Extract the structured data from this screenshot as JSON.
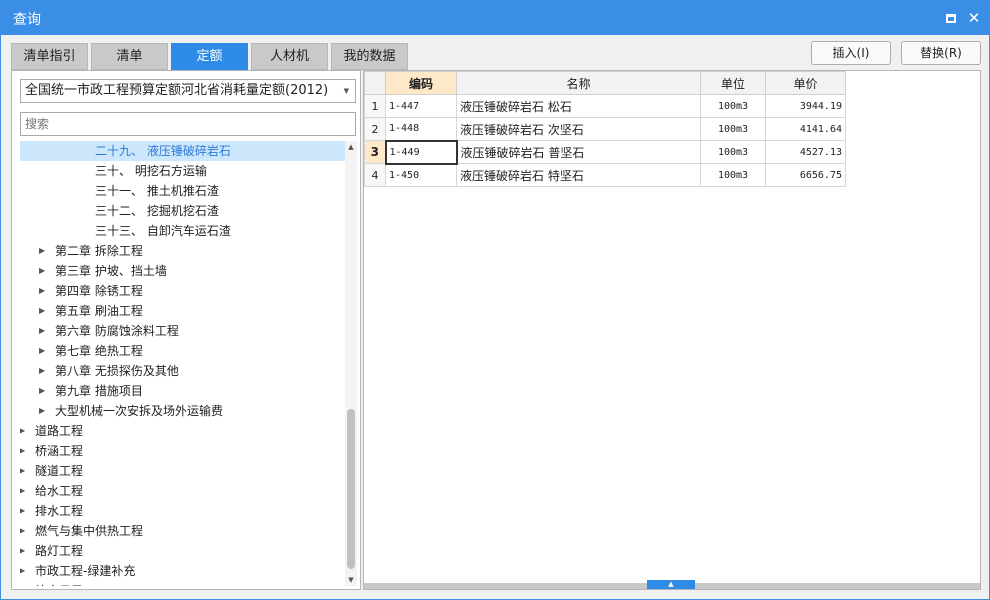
{
  "window": {
    "title": "查询",
    "maximize_icon": "maximize-icon",
    "close_label": "✕"
  },
  "tabs": [
    {
      "label": "清单指引",
      "active": false
    },
    {
      "label": "清单",
      "active": false
    },
    {
      "label": "定额",
      "active": true
    },
    {
      "label": "人材机",
      "active": false
    },
    {
      "label": "我的数据",
      "active": false
    }
  ],
  "actions": {
    "insert_label": "插入(I)",
    "replace_label": "替换(R)"
  },
  "left": {
    "dropdown_value": "全国统一市政工程预算定额河北省消耗量定额(2012)",
    "search_placeholder": "搜索",
    "tree": [
      {
        "text": "二十九、 液压锤破碎岩石",
        "level": 2,
        "caret": false,
        "selected": true
      },
      {
        "text": "三十、 明挖石方运输",
        "level": 2,
        "caret": false,
        "selected": false
      },
      {
        "text": "三十一、 推土机推石渣",
        "level": 2,
        "caret": false,
        "selected": false
      },
      {
        "text": "三十二、 挖掘机挖石渣",
        "level": 2,
        "caret": false,
        "selected": false
      },
      {
        "text": "三十三、 自卸汽车运石渣",
        "level": 2,
        "caret": false,
        "selected": false
      },
      {
        "text": "第二章 拆除工程",
        "level": 1,
        "caret": true,
        "selected": false
      },
      {
        "text": "第三章 护坡、挡土墙",
        "level": 1,
        "caret": true,
        "selected": false
      },
      {
        "text": "第四章 除锈工程",
        "level": 1,
        "caret": true,
        "selected": false
      },
      {
        "text": "第五章 刷油工程",
        "level": 1,
        "caret": true,
        "selected": false
      },
      {
        "text": "第六章 防腐蚀涂料工程",
        "level": 1,
        "caret": true,
        "selected": false
      },
      {
        "text": "第七章 绝热工程",
        "level": 1,
        "caret": true,
        "selected": false
      },
      {
        "text": "第八章 无损探伤及其他",
        "level": 1,
        "caret": true,
        "selected": false
      },
      {
        "text": "第九章 措施项目",
        "level": 1,
        "caret": true,
        "selected": false
      },
      {
        "text": "大型机械一次安拆及场外运输费",
        "level": 1,
        "caret": true,
        "selected": false
      },
      {
        "text": "道路工程",
        "level": 0,
        "caret": true,
        "selected": false
      },
      {
        "text": "桥涵工程",
        "level": 0,
        "caret": true,
        "selected": false
      },
      {
        "text": "隧道工程",
        "level": 0,
        "caret": true,
        "selected": false
      },
      {
        "text": "给水工程",
        "level": 0,
        "caret": true,
        "selected": false
      },
      {
        "text": "排水工程",
        "level": 0,
        "caret": true,
        "selected": false
      },
      {
        "text": "燃气与集中供热工程",
        "level": 0,
        "caret": true,
        "selected": false
      },
      {
        "text": "路灯工程",
        "level": 0,
        "caret": true,
        "selected": false
      },
      {
        "text": "市政工程-绿建补充",
        "level": 0,
        "caret": true,
        "selected": false
      },
      {
        "text": "补充子目",
        "level": 0,
        "caret": true,
        "selected": false
      }
    ]
  },
  "grid": {
    "headers": [
      "",
      "编码",
      "名称",
      "单位",
      "单价"
    ],
    "current_row": 3,
    "rows": [
      {
        "no": "1",
        "code": "1-447",
        "name": "液压锤破碎岩石 松石",
        "unit": "100m3",
        "price": "3944.19"
      },
      {
        "no": "2",
        "code": "1-448",
        "name": "液压锤破碎岩石 次坚石",
        "unit": "100m3",
        "price": "4141.64"
      },
      {
        "no": "3",
        "code": "1-449",
        "name": "液压锤破碎岩石 普坚石",
        "unit": "100m3",
        "price": "4527.13"
      },
      {
        "no": "4",
        "code": "1-450",
        "name": "液压锤破碎岩石 特坚石",
        "unit": "100m3",
        "price": "6656.75"
      }
    ]
  },
  "colors": {
    "accent": "#2f8be8",
    "selected_header": "#fde9c7",
    "tree_selected_bg": "#cce6fb"
  }
}
